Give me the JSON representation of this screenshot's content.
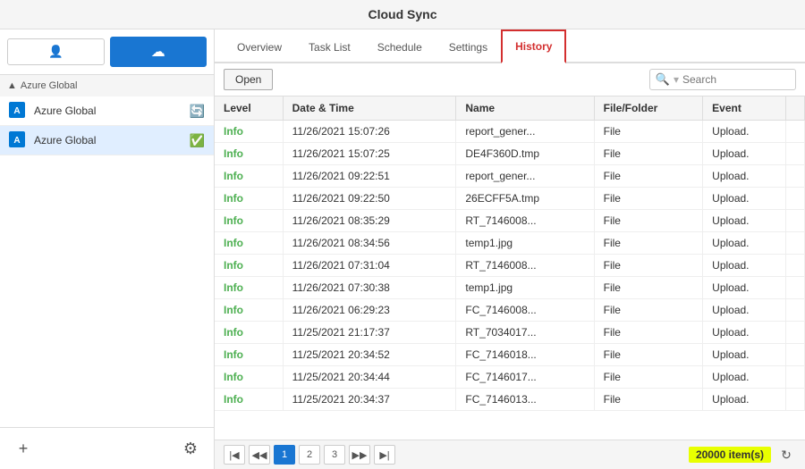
{
  "app": {
    "title": "Cloud Sync"
  },
  "sidebar": {
    "user_button_label": "User",
    "cloud_button_label": "Cloud",
    "group_label": "Azure Global",
    "items": [
      {
        "id": "azure-global-1",
        "label": "Azure Global",
        "badge": "sync"
      },
      {
        "id": "azure-global-2",
        "label": "Azure Global",
        "badge": "check"
      }
    ],
    "add_button": "+",
    "settings_button": "⚙"
  },
  "tabs": [
    {
      "id": "overview",
      "label": "Overview"
    },
    {
      "id": "tasklist",
      "label": "Task List"
    },
    {
      "id": "schedule",
      "label": "Schedule"
    },
    {
      "id": "settings",
      "label": "Settings"
    },
    {
      "id": "history",
      "label": "History",
      "active": true
    }
  ],
  "toolbar": {
    "open_button": "Open",
    "search_placeholder": "Search"
  },
  "table": {
    "columns": [
      "Level",
      "Date & Time",
      "Name",
      "File/Folder",
      "Event"
    ],
    "rows": [
      {
        "level": "Info",
        "datetime": "11/26/2021 15:07:26",
        "name": "report_gener...",
        "filefolder": "File",
        "event": "Upload."
      },
      {
        "level": "Info",
        "datetime": "11/26/2021 15:07:25",
        "name": "DE4F360D.tmp",
        "filefolder": "File",
        "event": "Upload."
      },
      {
        "level": "Info",
        "datetime": "11/26/2021 09:22:51",
        "name": "report_gener...",
        "filefolder": "File",
        "event": "Upload."
      },
      {
        "level": "Info",
        "datetime": "11/26/2021 09:22:50",
        "name": "26ECFF5A.tmp",
        "filefolder": "File",
        "event": "Upload."
      },
      {
        "level": "Info",
        "datetime": "11/26/2021 08:35:29",
        "name": "RT_7146008...",
        "filefolder": "File",
        "event": "Upload."
      },
      {
        "level": "Info",
        "datetime": "11/26/2021 08:34:56",
        "name": "temp1.jpg",
        "filefolder": "File",
        "event": "Upload."
      },
      {
        "level": "Info",
        "datetime": "11/26/2021 07:31:04",
        "name": "RT_7146008...",
        "filefolder": "File",
        "event": "Upload."
      },
      {
        "level": "Info",
        "datetime": "11/26/2021 07:30:38",
        "name": "temp1.jpg",
        "filefolder": "File",
        "event": "Upload."
      },
      {
        "level": "Info",
        "datetime": "11/26/2021 06:29:23",
        "name": "FC_7146008...",
        "filefolder": "File",
        "event": "Upload."
      },
      {
        "level": "Info",
        "datetime": "11/25/2021 21:17:37",
        "name": "RT_7034017...",
        "filefolder": "File",
        "event": "Upload."
      },
      {
        "level": "Info",
        "datetime": "11/25/2021 20:34:52",
        "name": "FC_7146018...",
        "filefolder": "File",
        "event": "Upload."
      },
      {
        "level": "Info",
        "datetime": "11/25/2021 20:34:44",
        "name": "FC_7146017...",
        "filefolder": "File",
        "event": "Upload."
      },
      {
        "level": "Info",
        "datetime": "11/25/2021 20:34:37",
        "name": "FC_7146013...",
        "filefolder": "File",
        "event": "Upload."
      }
    ]
  },
  "pagination": {
    "first_icon": "⊲",
    "prev_icon": "≪",
    "next_icon": "≫",
    "last_icon": "⊳",
    "pages": [
      "1",
      "2",
      "3"
    ],
    "active_page": "1",
    "items_count": "20000 item(s)",
    "refresh_icon": "↻"
  }
}
